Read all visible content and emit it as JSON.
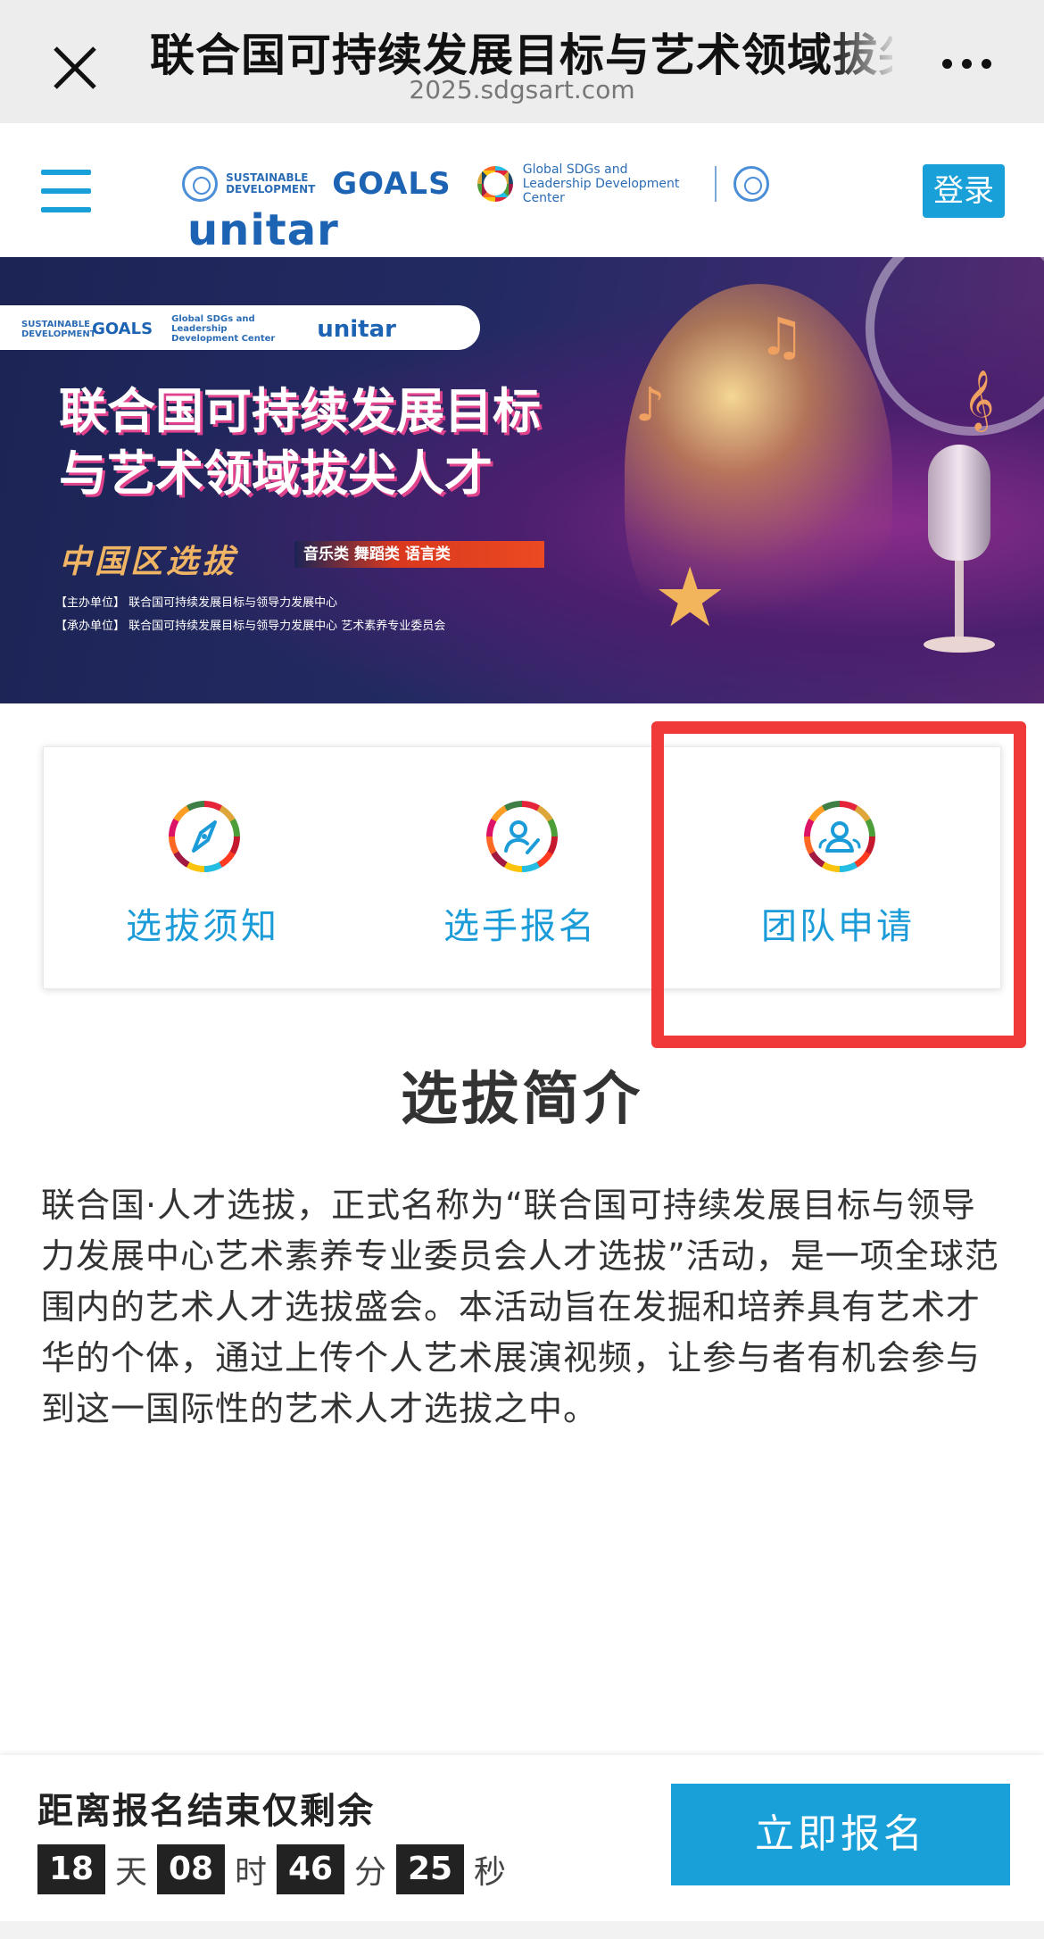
{
  "browser": {
    "title": "联合国可持续发展目标与艺术领域拔尖人才",
    "url": "2025.sdgsart.com"
  },
  "header": {
    "logo_sdg_small": "SUSTAINABLE DEVELOPMENT",
    "logo_goals": "GOALS",
    "logo_gc": "Global SDGs and Leadership Development Center",
    "logo_unitar": "unitar",
    "login_label": "登录"
  },
  "banner": {
    "title_line1": "联合国可持续发展目标",
    "title_line2": "与艺术领域拔尖人才",
    "subtitle": "中国区选拔",
    "tag": "音乐类 舞蹈类 语言类",
    "organizer": "【主办单位】 联合国可持续发展目标与领导力发展中心",
    "undertaker": "【承办单位】 联合国可持续发展目标与领导力发展中心   艺术素养专业委员会"
  },
  "actions": [
    {
      "label": "选拔须知",
      "icon": "compass-icon"
    },
    {
      "label": "选手报名",
      "icon": "person-edit-icon"
    },
    {
      "label": "团队申请",
      "icon": "team-icon"
    }
  ],
  "intro": {
    "title": "选拔简介",
    "body": "联合国·人才选拔，正式名称为“联合国可持续发展目标与领导力发展中心艺术素养专业委员会人才选拔”活动，是一项全球范围内的艺术人才选拔盛会。本活动旨在发掘和培养具有艺术才华的个体，通过上传个人艺术展演视频，让参与者有机会参与到这一国际性的艺术人才选拔之中。"
  },
  "countdown": {
    "title": "距离报名结束仅剩余",
    "days": "18",
    "days_unit": "天",
    "hours": "08",
    "hours_unit": "时",
    "minutes": "46",
    "minutes_unit": "分",
    "seconds": "25",
    "seconds_unit": "秒"
  },
  "signup_label": "立即报名",
  "colors": {
    "accent": "#1aa0d8",
    "highlight": "#f03a3a"
  }
}
